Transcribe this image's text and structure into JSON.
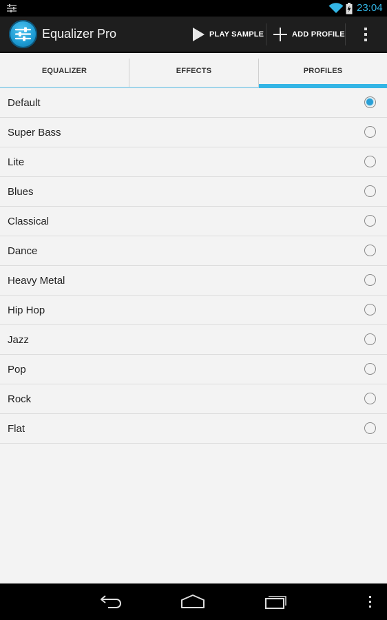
{
  "status_bar": {
    "time": "23:04",
    "left_icon": "equalizer-notification-icon",
    "wifi_icon": "wifi-icon",
    "battery_icon": "battery-charging-icon",
    "accent": "#33b5e5"
  },
  "action_bar": {
    "app_title": "Equalizer Pro",
    "logo_icon": "equalizer-app-icon",
    "play_sample_label": "PLAY SAMPLE",
    "play_sample_icon": "play-icon",
    "add_profile_label": "ADD PROFILE",
    "add_profile_icon": "plus-icon",
    "overflow_icon": "overflow-menu-icon"
  },
  "tabs": [
    {
      "label": "EQUALIZER",
      "selected": false
    },
    {
      "label": "EFFECTS",
      "selected": false
    },
    {
      "label": "PROFILES",
      "selected": true
    }
  ],
  "profiles": [
    {
      "name": "Default",
      "selected": true
    },
    {
      "name": "Super Bass",
      "selected": false
    },
    {
      "name": "Lite",
      "selected": false
    },
    {
      "name": "Blues",
      "selected": false
    },
    {
      "name": "Classical",
      "selected": false
    },
    {
      "name": "Dance",
      "selected": false
    },
    {
      "name": "Heavy Metal",
      "selected": false
    },
    {
      "name": "Hip Hop",
      "selected": false
    },
    {
      "name": "Jazz",
      "selected": false
    },
    {
      "name": "Pop",
      "selected": false
    },
    {
      "name": "Rock",
      "selected": false
    },
    {
      "name": "Flat",
      "selected": false
    }
  ],
  "nav_bar": {
    "back_icon": "back-icon",
    "home_icon": "home-icon",
    "recents_icon": "recent-apps-icon",
    "menu_icon": "menu-icon"
  },
  "colors": {
    "accent": "#33b5e5",
    "action_bar": "#1e1e1e",
    "background": "#f3f3f3"
  }
}
